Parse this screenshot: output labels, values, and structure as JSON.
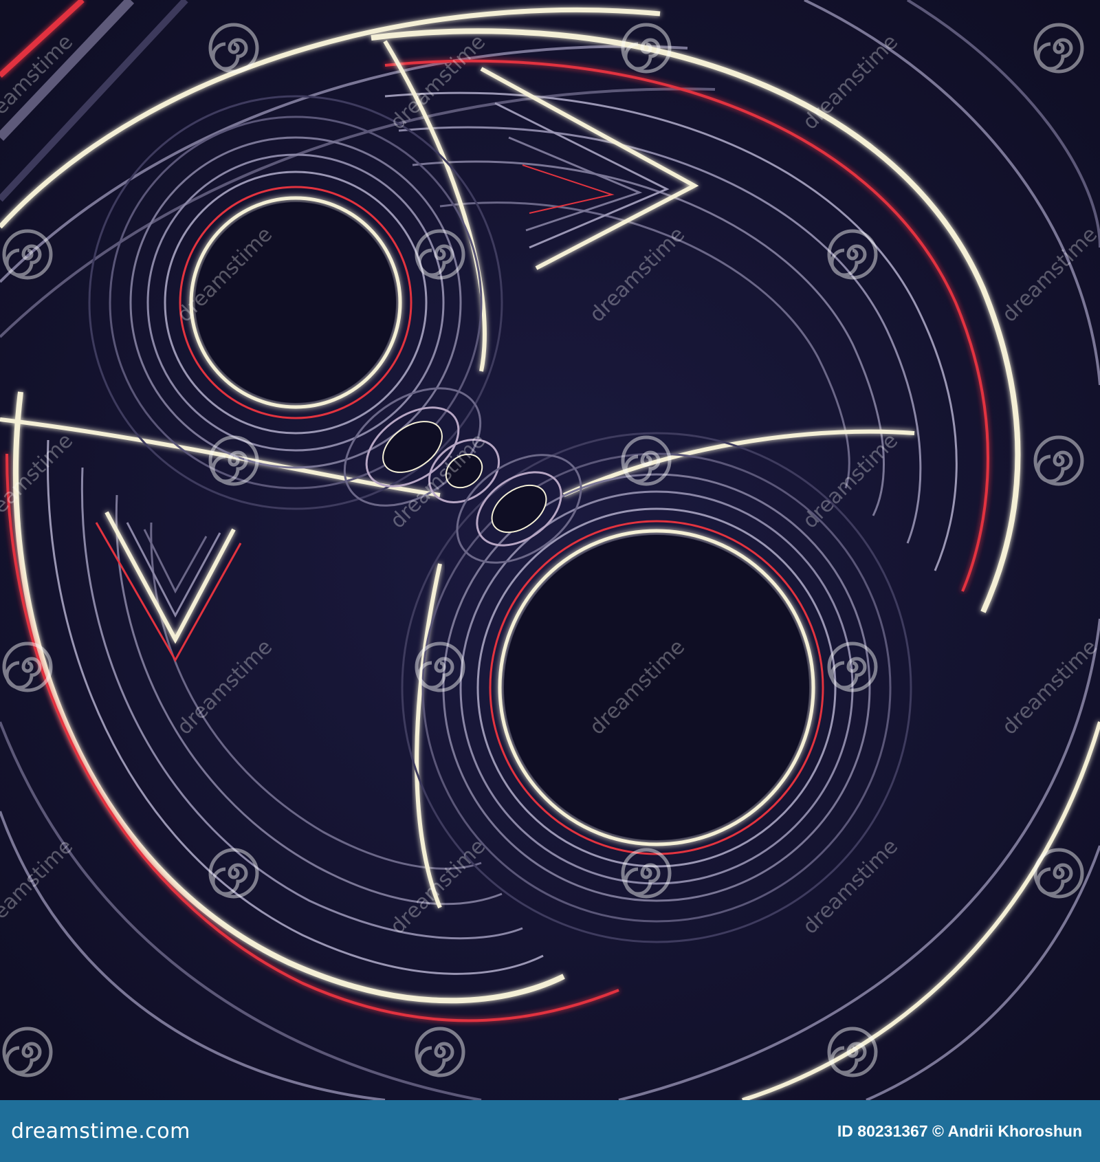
{
  "image": {
    "colors": {
      "background": "#14132e",
      "line_light": "#f4efd6",
      "line_red": "#e2333f",
      "line_dim": "#9a96b4",
      "footer": "#1f6f9a"
    }
  },
  "watermark": {
    "text": "dreamstime",
    "icon": "spiral-icon"
  },
  "footer": {
    "brand": "dreamstime.com",
    "credit": "ID 80231367 © Andrii Khoroshun"
  }
}
